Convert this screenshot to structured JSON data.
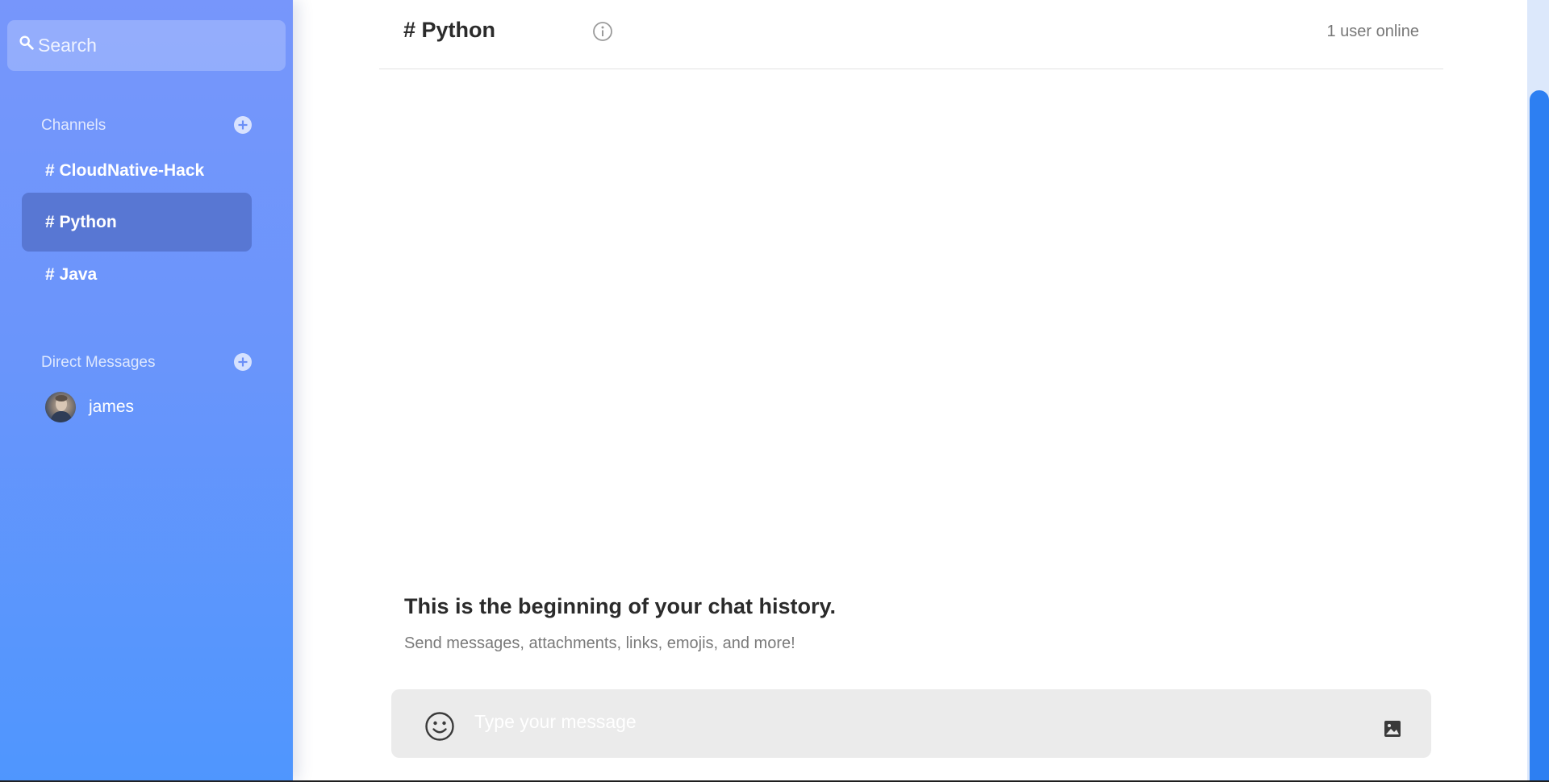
{
  "search": {
    "placeholder": "Search"
  },
  "sidebar": {
    "channels_title": "Channels",
    "channels": [
      {
        "label": "# CloudNative-Hack",
        "active": false
      },
      {
        "label": "# Python",
        "active": true
      },
      {
        "label": "# Java",
        "active": false
      }
    ],
    "direct_messages_title": "Direct Messages",
    "direct_messages": [
      {
        "name": "james"
      }
    ]
  },
  "header": {
    "channel_title": "# Python",
    "online_status": "1 user online"
  },
  "chat": {
    "history_title": "This is the beginning of your chat history.",
    "history_subtitle": "Send messages, attachments, links, emojis, and more!"
  },
  "composer": {
    "placeholder": "Type your message"
  },
  "colors": {
    "sidebar_top": "#7796fb",
    "sidebar_bottom": "#4f96fe",
    "active_channel": "#5877d3",
    "scrollbar_thumb": "#2d7ff2",
    "composer_bg": "#ebebeb"
  },
  "icons": {
    "search": "search-icon",
    "add": "plus-circle-icon",
    "info": "info-icon",
    "emoji": "smiley-icon",
    "image": "image-icon"
  }
}
